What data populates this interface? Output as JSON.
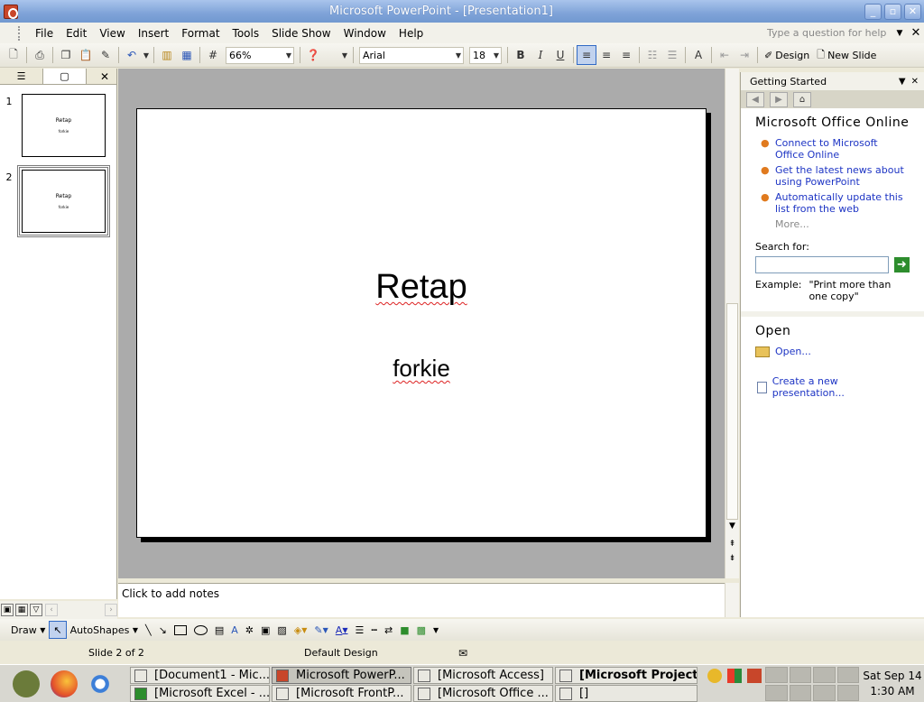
{
  "window": {
    "title": "Microsoft PowerPoint - [Presentation1]"
  },
  "menu": {
    "items": [
      "File",
      "Edit",
      "View",
      "Insert",
      "Format",
      "Tools",
      "Slide Show",
      "Window",
      "Help"
    ],
    "help_placeholder": "Type a question for help"
  },
  "toolbar": {
    "zoom": "66%",
    "font": "Arial",
    "font_size": "18",
    "bold": "B",
    "italic": "I",
    "underline": "U",
    "design_label": "Design",
    "new_slide_label": "New Slide"
  },
  "slides": [
    {
      "num": "1",
      "title": "Retap",
      "subtitle": "forkie"
    },
    {
      "num": "2",
      "title": "Retap",
      "subtitle": "forkie"
    }
  ],
  "current_slide": {
    "title": "Retap",
    "subtitle": "forkie"
  },
  "notes": {
    "placeholder": "Click to add notes"
  },
  "taskpane": {
    "header": "Getting Started",
    "online_heading": "Microsoft Office Online",
    "links": [
      "Connect to Microsoft Office Online",
      "Get the latest news about using PowerPoint",
      "Automatically update this list from the web"
    ],
    "more": "More...",
    "search_label": "Search for:",
    "example_label": "Example:",
    "example_text": "\"Print more than one copy\"",
    "open_heading": "Open",
    "open_link": "Open...",
    "create_link": "Create a new presentation..."
  },
  "drawbar": {
    "draw_label": "Draw",
    "autoshapes_label": "AutoShapes"
  },
  "status": {
    "slide_info": "Slide 2 of 2",
    "design": "Default Design"
  },
  "taskbar": {
    "row1": [
      "[Document1 - Mic...",
      "Microsoft PowerP...",
      "[Microsoft Access]",
      "[Microsoft Project..."
    ],
    "row2": [
      "[Microsoft Excel - ...",
      "[Microsoft FrontP...",
      "[Microsoft Office ...",
      "[]"
    ],
    "clock_day": "Sat Sep 14",
    "clock_time": "1:30 AM"
  }
}
